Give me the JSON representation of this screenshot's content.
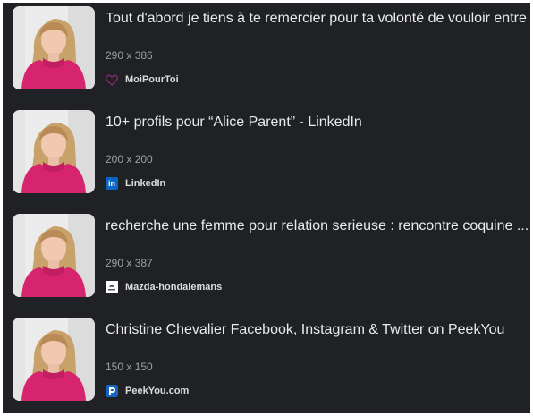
{
  "results": [
    {
      "title": "Tout d'abord je tiens à te remercier pour ta volonté de vouloir entre",
      "dims": "290 x 386",
      "source": "MoiPourToi",
      "favicon": "heart-outline-icon",
      "favicon_color": "#7b2d6b"
    },
    {
      "title": "10+ profils pour “Alice Parent” - LinkedIn",
      "dims": "200 x 200",
      "source": "LinkedIn",
      "favicon": "linkedin-icon",
      "favicon_color": "#0a66c2",
      "favicon_text": "in"
    },
    {
      "title": "recherche une femme pour relation serieuse : rencontre coquine ...",
      "dims": "290 x 387",
      "source": "Mazda-hondalemans",
      "favicon": "mazda-logo-icon",
      "favicon_color": "#ffffff"
    },
    {
      "title": "Christine Chevalier Facebook, Instagram & Twitter on PeekYou",
      "dims": "150 x 150",
      "source": "PeekYou.com",
      "favicon": "peekyou-icon",
      "favicon_color": "#1565c0"
    }
  ],
  "colors": {
    "background": "#202124",
    "title": "#e8eaed",
    "secondary": "#9aa0a6",
    "thumbnail_top": "#f3f3f3",
    "thumbnail_sweater": "#d6246e"
  }
}
